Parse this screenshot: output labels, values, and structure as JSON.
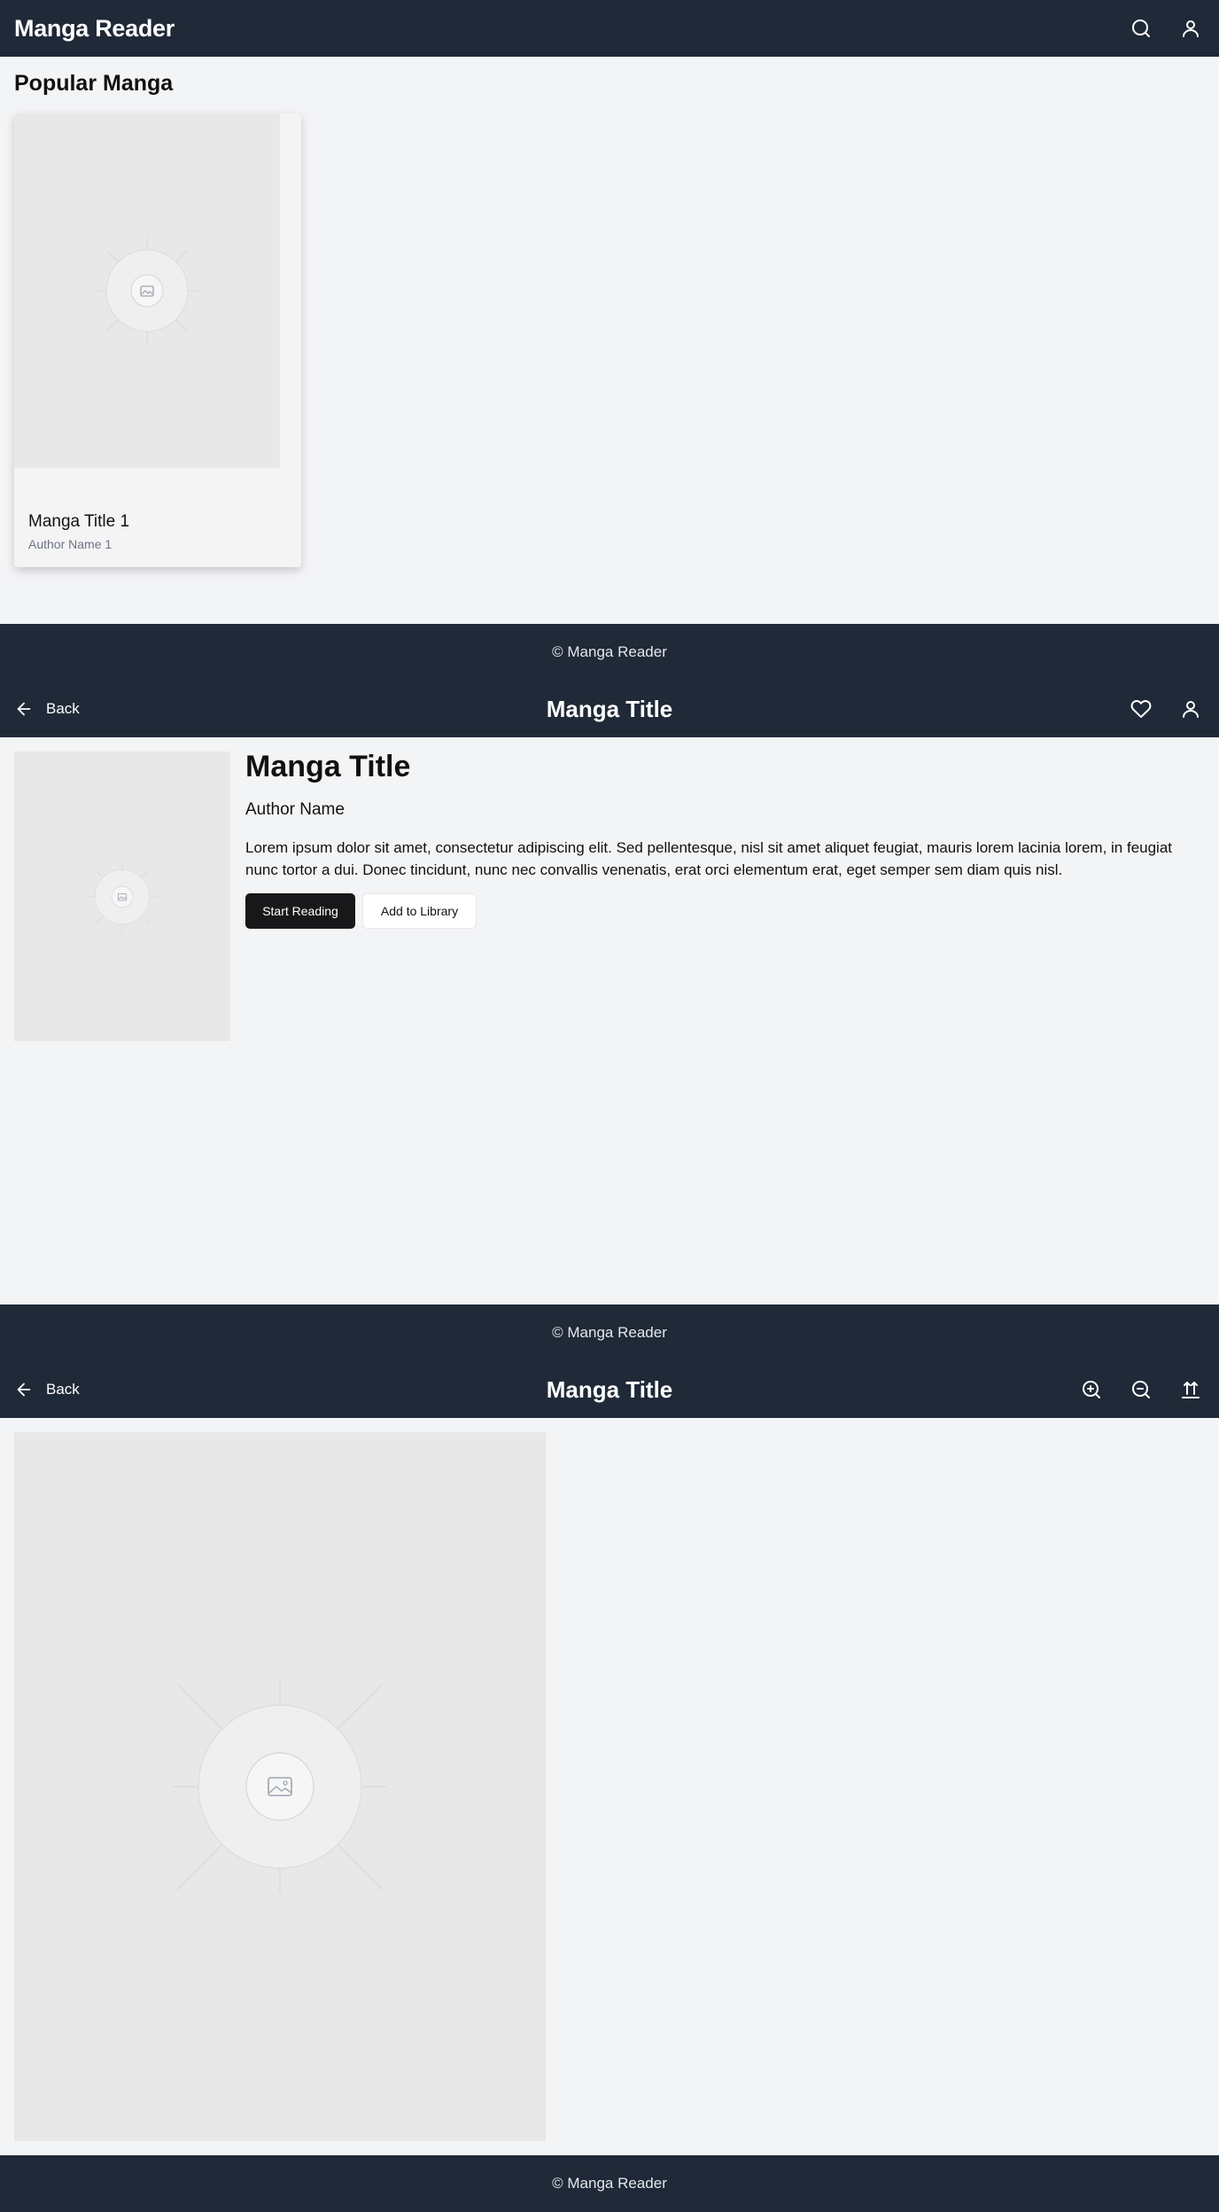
{
  "home": {
    "header": {
      "brand": "Manga Reader",
      "search_icon": "search-icon",
      "user_icon": "user-icon"
    },
    "section_title": "Popular Manga",
    "cards": [
      {
        "title": "Manga Title 1",
        "author": "Author Name 1"
      }
    ],
    "footer": "© Manga Reader"
  },
  "detail": {
    "header": {
      "back_label": "Back",
      "title": "Manga Title",
      "favorite_icon": "heart-icon",
      "user_icon": "user-icon"
    },
    "title": "Manga Title",
    "author": "Author Name",
    "description": "Lorem ipsum dolor sit amet, consectetur adipiscing elit. Sed pellentesque, nisl sit amet aliquet feugiat, mauris lorem lacinia lorem, in feugiat nunc tortor a dui. Donec tincidunt, nunc nec convallis venenatis, erat orci elementum erat, eget semper sem diam quis nisl.",
    "start_reading": "Start Reading",
    "add_to_library": "Add to Library",
    "footer": "© Manga Reader"
  },
  "reader": {
    "header": {
      "back_label": "Back",
      "title": "Manga Title",
      "zoom_in_icon": "zoom-in-icon",
      "zoom_out_icon": "zoom-out-icon",
      "scroll_top_icon": "scroll-to-top-icon"
    },
    "footer": "© Manga Reader"
  },
  "colors": {
    "header_bg": "#1f2937",
    "page_bg": "#f3f4f6",
    "placeholder_bg": "#e8e8e8",
    "primary_button": "#18181b"
  }
}
